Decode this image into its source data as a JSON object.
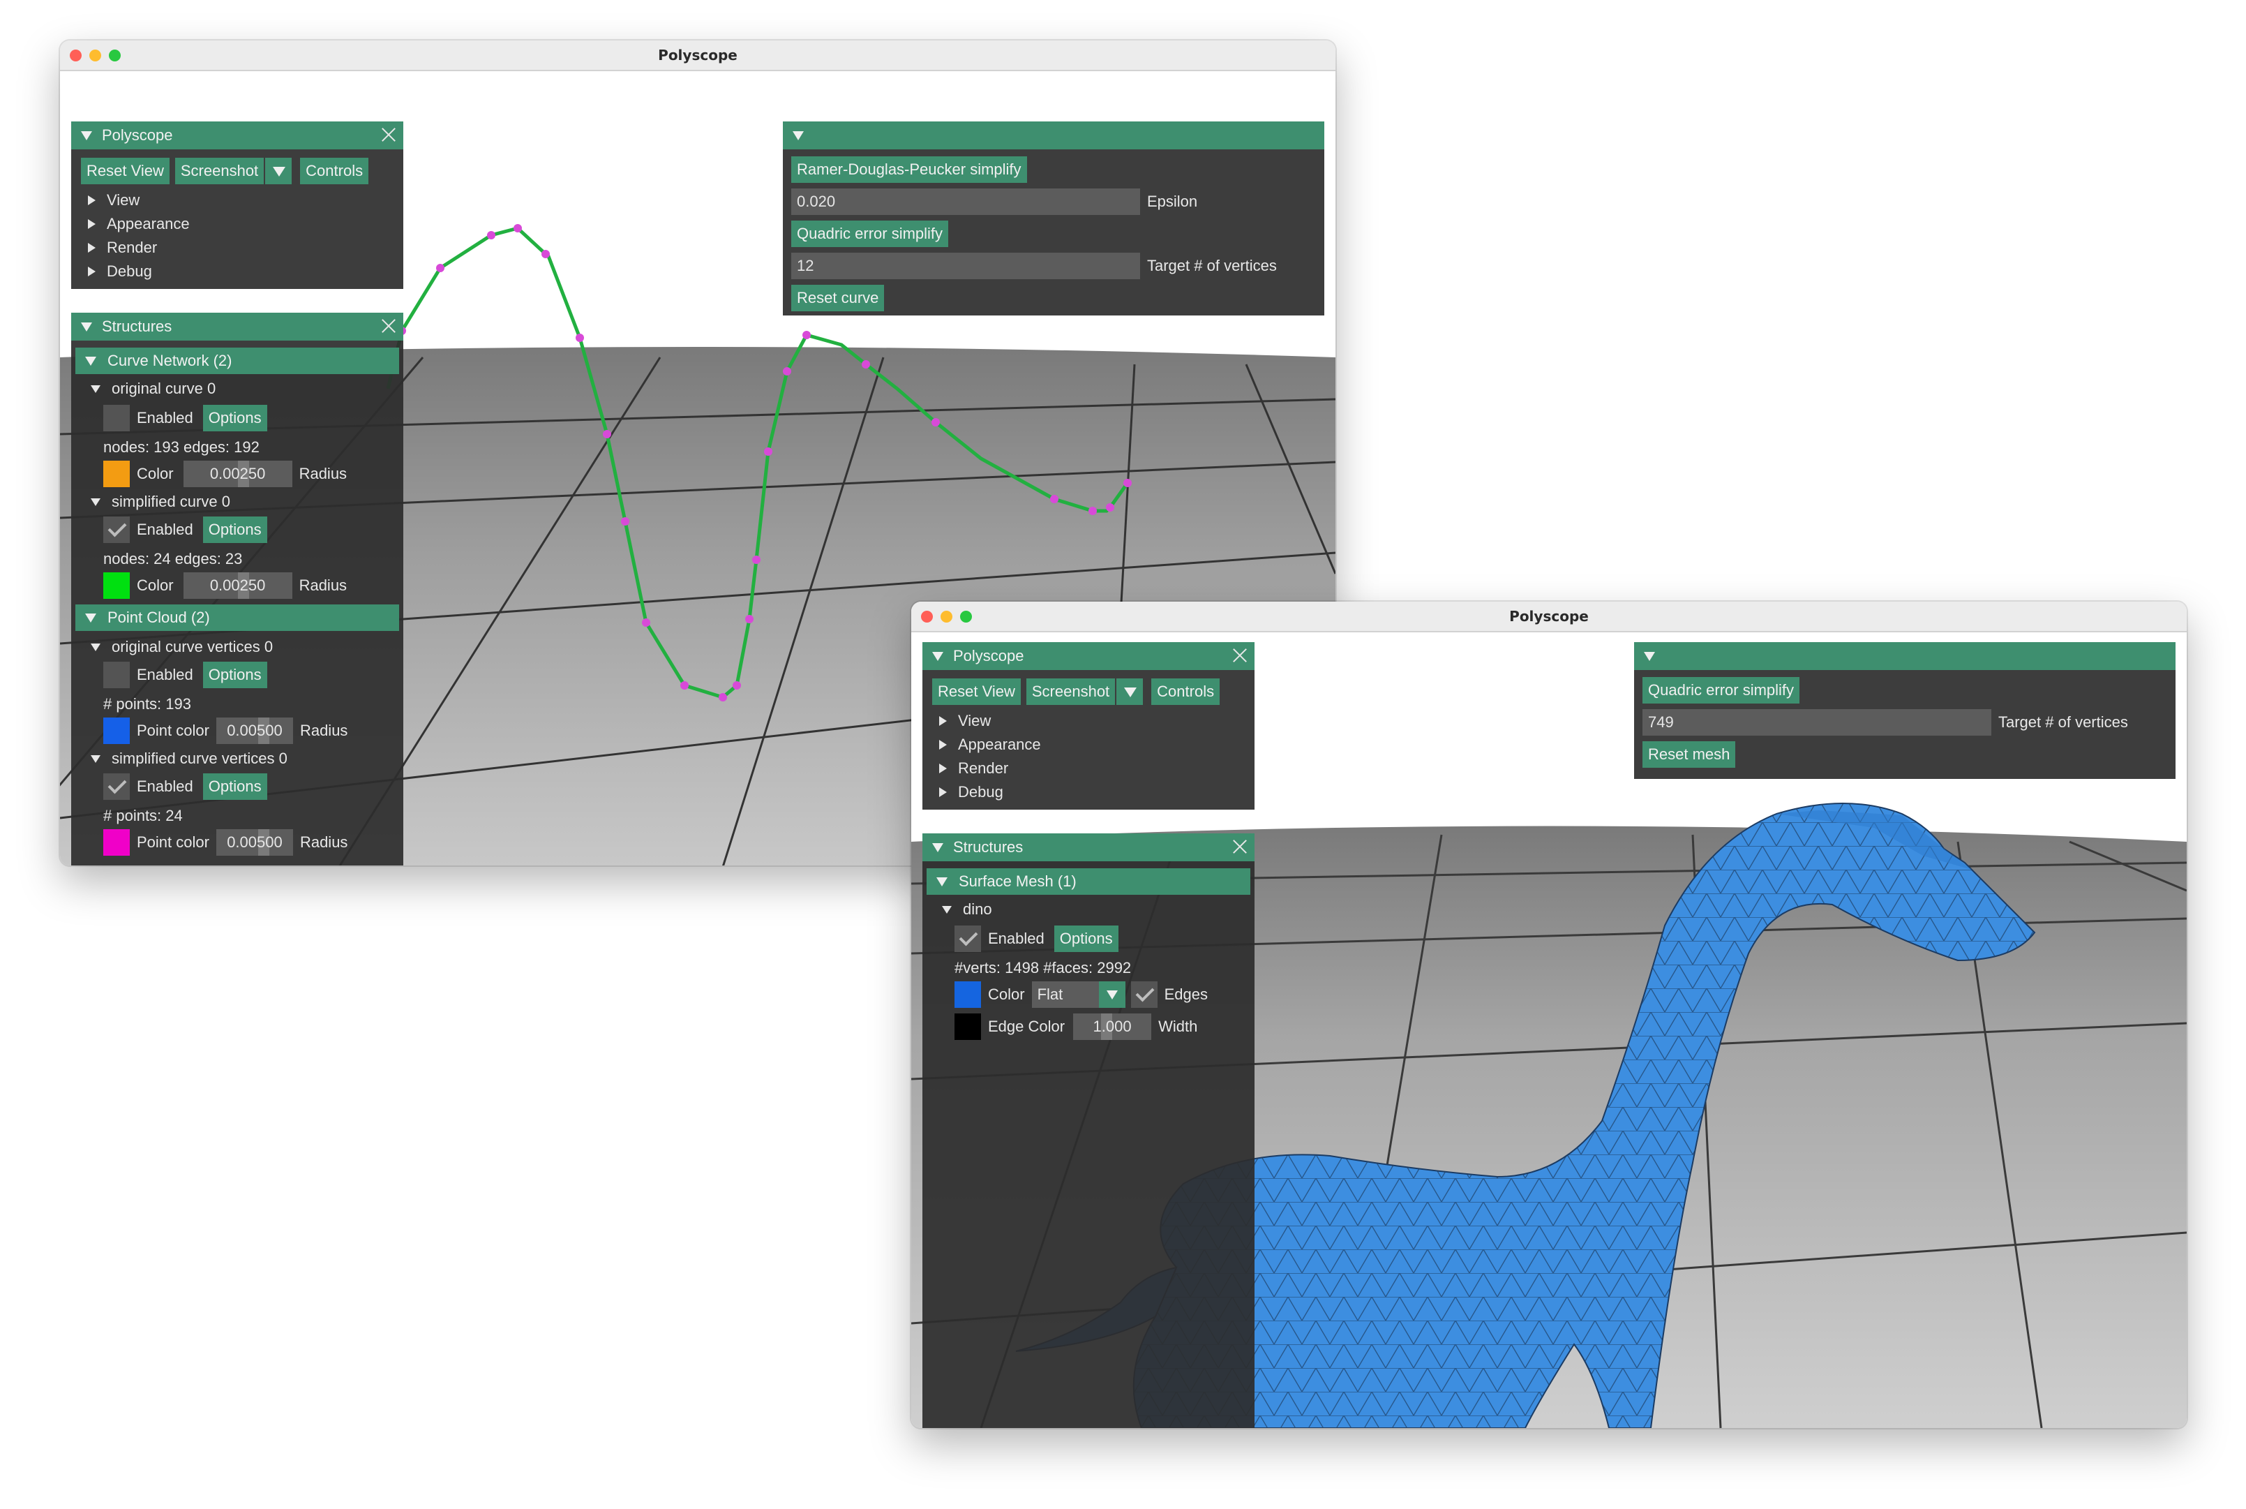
{
  "window1": {
    "title": "Polyscope",
    "polyscope_panel": {
      "title": "Polyscope",
      "buttons": {
        "reset_view": "Reset View",
        "screenshot": "Screenshot",
        "controls": "Controls"
      },
      "tree": [
        "View",
        "Appearance",
        "Render",
        "Debug"
      ]
    },
    "tools_panel": {
      "rdp_button": "Ramer-Douglas-Peucker simplify",
      "epsilon_value": "0.020",
      "epsilon_label": "Epsilon",
      "quadric_button": "Quadric error simplify",
      "target_value": "12",
      "target_label": "Target # of vertices",
      "reset_button": "Reset curve"
    },
    "structures_panel": {
      "title": "Structures",
      "curve_network": {
        "header": "Curve Network (2)",
        "original": {
          "name": "original curve 0",
          "enabled_label": "Enabled",
          "options": "Options",
          "stats": "nodes: 193  edges: 192",
          "color_label": "Color",
          "radius_value": "0.00250",
          "radius_label": "Radius",
          "color": "#f39c12",
          "enabled": false
        },
        "simplified": {
          "name": "simplified curve 0",
          "enabled_label": "Enabled",
          "options": "Options",
          "stats": "nodes: 24  edges: 23",
          "color_label": "Color",
          "radius_value": "0.00250",
          "radius_label": "Radius",
          "color": "#00e010",
          "enabled": true
        }
      },
      "point_cloud": {
        "header": "Point Cloud (2)",
        "original": {
          "name": "original curve vertices 0",
          "enabled_label": "Enabled",
          "options": "Options",
          "stats": "# points: 193",
          "color_label": "Point color",
          "radius_value": "0.00500",
          "radius_label": "Radius",
          "color": "#1560e8",
          "enabled": false
        },
        "simplified": {
          "name": "simplified curve vertices 0",
          "enabled_label": "Enabled",
          "options": "Options",
          "stats": "# points: 24",
          "color_label": "Point color",
          "radius_value": "0.00500",
          "radius_label": "Radius",
          "color": "#f000c8",
          "enabled": true
        }
      }
    }
  },
  "window2": {
    "title": "Polyscope",
    "polyscope_panel": {
      "title": "Polyscope",
      "buttons": {
        "reset_view": "Reset View",
        "screenshot": "Screenshot",
        "controls": "Controls"
      },
      "tree": [
        "View",
        "Appearance",
        "Render",
        "Debug"
      ]
    },
    "tools_panel": {
      "quadric_button": "Quadric error simplify",
      "target_value": "749",
      "target_label": "Target # of vertices",
      "reset_button": "Reset mesh"
    },
    "structures_panel": {
      "title": "Structures",
      "surface_mesh": {
        "header": "Surface Mesh (1)",
        "name": "dino",
        "enabled_label": "Enabled",
        "options": "Options",
        "stats": "#verts: 1498  #faces: 2992",
        "color_label": "Color",
        "color": "#1565e0",
        "shade_value": "Flat",
        "edges_label": "Edges",
        "edge_color_label": "Edge Color",
        "edge_color": "#000000",
        "width_value": "1.000",
        "width_label": "Width"
      }
    }
  },
  "colors": {
    "accent": "#3e8f6f",
    "panel_bg": "#2c2c2c",
    "mesh_blue": "#3d8ee0",
    "curve_green": "#22b040",
    "vertex_magenta": "#e040e0"
  }
}
